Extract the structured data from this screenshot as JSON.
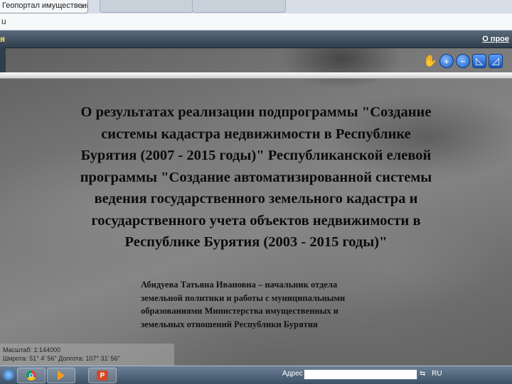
{
  "browser": {
    "tab_title": "Геопортал имущественн",
    "tab_close": "×",
    "address_fragment": "u"
  },
  "map": {
    "header_left": "я",
    "header_right": "О прое",
    "status": {
      "scale": "Масштаб: 1:144000",
      "coords": "Широта: 51° 4' 56\"  Долгота: 107° 31' 56\""
    },
    "toolbar_icons": [
      "hand-icon",
      "zoom-in-icon",
      "zoom-out-icon",
      "measure-icon",
      "area-icon"
    ]
  },
  "slide": {
    "title_lines": [
      "О результатах реализации подпрограммы \"Создание",
      "системы кадастра недвижимости в Республике",
      "Бурятия (2007 - 2015 годы)\" Республиканской елевой",
      "программы \"Создание автоматизированной системы",
      "ведения государственного земельного кадастра и",
      "государственного учета объектов недвижимости в",
      "Республике Бурятия (2003 - 2015 годы)\""
    ],
    "author_lines": [
      "Абидуева Татьяна Ивановна – начальник отдела",
      "земельной политики и  работы с муниципальными",
      "образованиями Министерства имущественных и",
      "земельных отношений Республики Бурятия"
    ]
  },
  "taskbar": {
    "address_label": "Адрес",
    "tray_lang": "RU",
    "tray_arrow": "⇆"
  }
}
